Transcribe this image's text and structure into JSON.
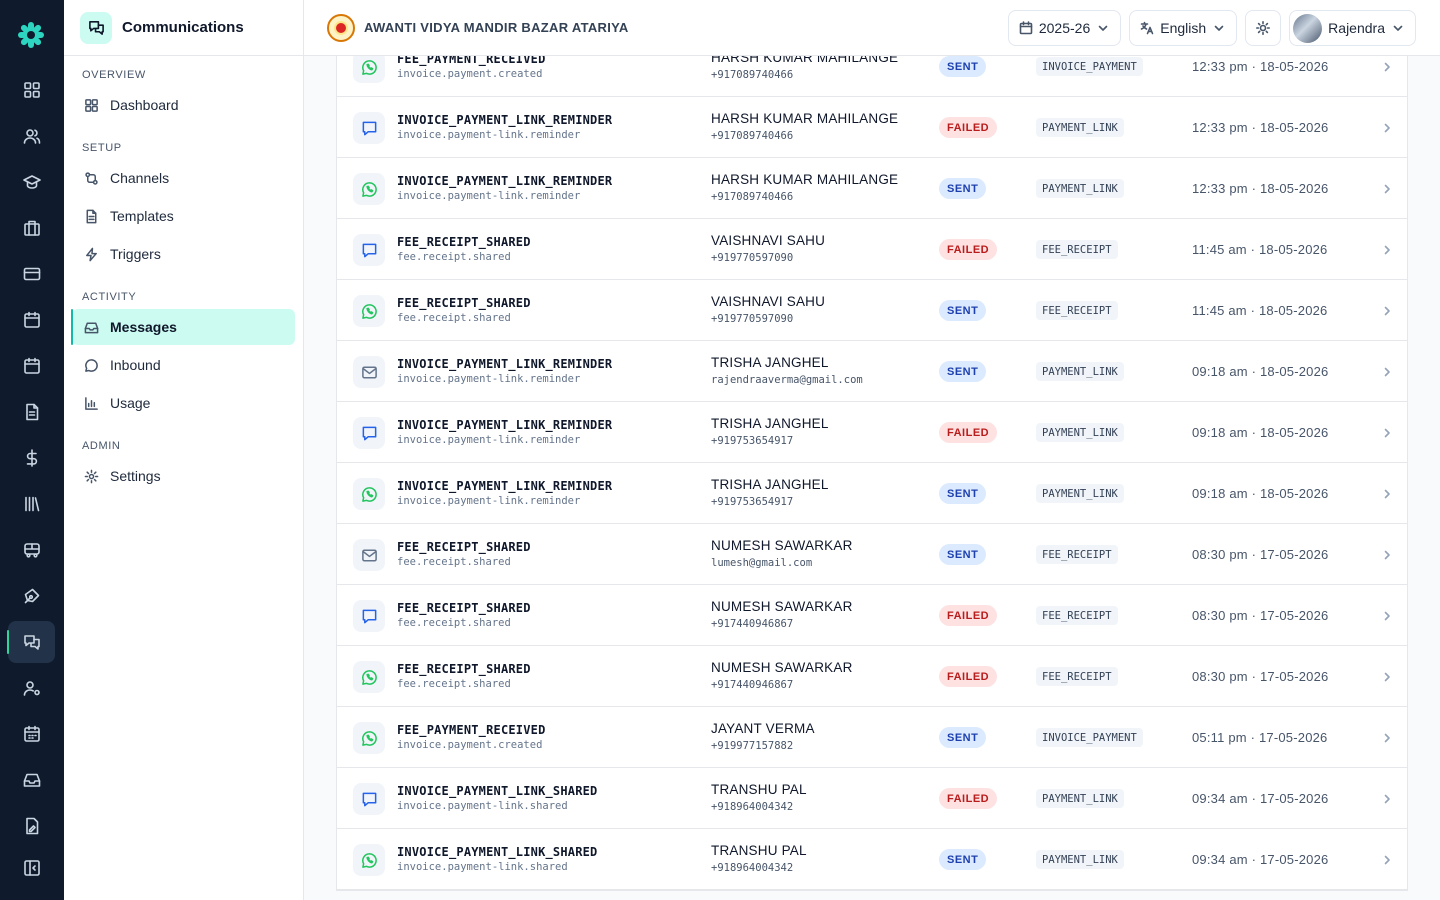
{
  "app": {
    "title": "Communications",
    "school_name": "AWANTI VIDYA MANDIR BAZAR ATARIYA"
  },
  "header": {
    "year": "2025-26",
    "language": "English",
    "user": "Rajendra"
  },
  "sidebar": {
    "sections": [
      {
        "label": "OVERVIEW",
        "items": [
          {
            "label": "Dashboard",
            "icon": "dashboard-icon"
          }
        ]
      },
      {
        "label": "SETUP",
        "items": [
          {
            "label": "Channels",
            "icon": "channels-icon"
          },
          {
            "label": "Templates",
            "icon": "templates-icon"
          },
          {
            "label": "Triggers",
            "icon": "triggers-icon"
          }
        ]
      },
      {
        "label": "ACTIVITY",
        "items": [
          {
            "label": "Messages",
            "icon": "messages-icon",
            "active": true
          },
          {
            "label": "Inbound",
            "icon": "inbound-icon"
          },
          {
            "label": "Usage",
            "icon": "usage-icon"
          }
        ]
      },
      {
        "label": "ADMIN",
        "items": [
          {
            "label": "Settings",
            "icon": "settings-icon"
          }
        ]
      }
    ]
  },
  "colors": {
    "rail_bg": "#0f1b2d",
    "accent": "#14b8a6",
    "sent_badge": "#dbeafe",
    "failed_badge": "#fee2e2",
    "whatsapp": "#22c55e"
  },
  "messages": [
    {
      "channel": "whatsapp",
      "event": "FEE_PAYMENT_RECEIVED",
      "key": "invoice.payment.created",
      "recipient": "HARSH KUMAR MAHILANGE",
      "address": "+917089740466",
      "status": "SENT",
      "ref": "INVOICE_PAYMENT",
      "time": "12:33 pm · 18-05-2026"
    },
    {
      "channel": "sms",
      "event": "INVOICE_PAYMENT_LINK_REMINDER",
      "key": "invoice.payment-link.reminder",
      "recipient": "HARSH KUMAR MAHILANGE",
      "address": "+917089740466",
      "status": "FAILED",
      "ref": "PAYMENT_LINK",
      "time": "12:33 pm · 18-05-2026"
    },
    {
      "channel": "whatsapp",
      "event": "INVOICE_PAYMENT_LINK_REMINDER",
      "key": "invoice.payment-link.reminder",
      "recipient": "HARSH KUMAR MAHILANGE",
      "address": "+917089740466",
      "status": "SENT",
      "ref": "PAYMENT_LINK",
      "time": "12:33 pm · 18-05-2026"
    },
    {
      "channel": "sms",
      "event": "FEE_RECEIPT_SHARED",
      "key": "fee.receipt.shared",
      "recipient": "VAISHNAVI SAHU",
      "address": "+919770597090",
      "status": "FAILED",
      "ref": "FEE_RECEIPT",
      "time": "11:45 am · 18-05-2026"
    },
    {
      "channel": "whatsapp",
      "event": "FEE_RECEIPT_SHARED",
      "key": "fee.receipt.shared",
      "recipient": "VAISHNAVI SAHU",
      "address": "+919770597090",
      "status": "SENT",
      "ref": "FEE_RECEIPT",
      "time": "11:45 am · 18-05-2026"
    },
    {
      "channel": "email",
      "event": "INVOICE_PAYMENT_LINK_REMINDER",
      "key": "invoice.payment-link.reminder",
      "recipient": "TRISHA JANGHEL",
      "address": "rajendraaverma@gmail.com",
      "status": "SENT",
      "ref": "PAYMENT_LINK",
      "time": "09:18 am · 18-05-2026"
    },
    {
      "channel": "sms",
      "event": "INVOICE_PAYMENT_LINK_REMINDER",
      "key": "invoice.payment-link.reminder",
      "recipient": "TRISHA JANGHEL",
      "address": "+919753654917",
      "status": "FAILED",
      "ref": "PAYMENT_LINK",
      "time": "09:18 am · 18-05-2026"
    },
    {
      "channel": "whatsapp",
      "event": "INVOICE_PAYMENT_LINK_REMINDER",
      "key": "invoice.payment-link.reminder",
      "recipient": "TRISHA JANGHEL",
      "address": "+919753654917",
      "status": "SENT",
      "ref": "PAYMENT_LINK",
      "time": "09:18 am · 18-05-2026"
    },
    {
      "channel": "email",
      "event": "FEE_RECEIPT_SHARED",
      "key": "fee.receipt.shared",
      "recipient": "NUMESH SAWARKAR",
      "address": "lumesh@gmail.com",
      "status": "SENT",
      "ref": "FEE_RECEIPT",
      "time": "08:30 pm · 17-05-2026"
    },
    {
      "channel": "sms",
      "event": "FEE_RECEIPT_SHARED",
      "key": "fee.receipt.shared",
      "recipient": "NUMESH SAWARKAR",
      "address": "+917440946867",
      "status": "FAILED",
      "ref": "FEE_RECEIPT",
      "time": "08:30 pm · 17-05-2026"
    },
    {
      "channel": "whatsapp",
      "event": "FEE_RECEIPT_SHARED",
      "key": "fee.receipt.shared",
      "recipient": "NUMESH SAWARKAR",
      "address": "+917440946867",
      "status": "FAILED",
      "ref": "FEE_RECEIPT",
      "time": "08:30 pm · 17-05-2026"
    },
    {
      "channel": "whatsapp",
      "event": "FEE_PAYMENT_RECEIVED",
      "key": "invoice.payment.created",
      "recipient": "JAYANT VERMA",
      "address": "+919977157882",
      "status": "SENT",
      "ref": "INVOICE_PAYMENT",
      "time": "05:11 pm · 17-05-2026"
    },
    {
      "channel": "sms",
      "event": "INVOICE_PAYMENT_LINK_SHARED",
      "key": "invoice.payment-link.shared",
      "recipient": "TRANSHU PAL",
      "address": "+918964004342",
      "status": "FAILED",
      "ref": "PAYMENT_LINK",
      "time": "09:34 am · 17-05-2026"
    },
    {
      "channel": "whatsapp",
      "event": "INVOICE_PAYMENT_LINK_SHARED",
      "key": "invoice.payment-link.shared",
      "recipient": "TRANSHU PAL",
      "address": "+918964004342",
      "status": "SENT",
      "ref": "PAYMENT_LINK",
      "time": "09:34 am · 17-05-2026"
    }
  ]
}
